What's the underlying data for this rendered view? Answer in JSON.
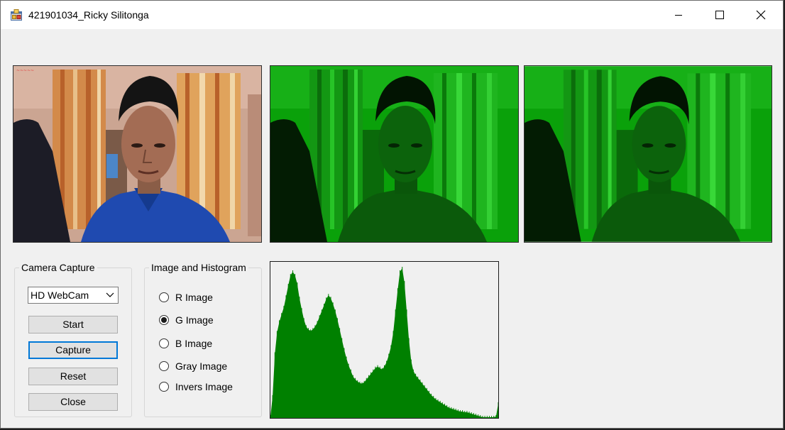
{
  "window": {
    "title": "421901034_Ricky Silitonga",
    "app_icon": "winforms-app-icon",
    "controls": [
      "minimize-icon",
      "maximize-icon",
      "close-icon"
    ]
  },
  "camera_group": {
    "title": "Camera Capture",
    "device_selected": "HD WebCam",
    "buttons": {
      "start": "Start",
      "capture": "Capture",
      "reset": "Reset",
      "close": "Close"
    }
  },
  "image_group": {
    "title": "Image and Histogram",
    "options": [
      {
        "label": "R Image",
        "checked": false
      },
      {
        "label": "G Image",
        "checked": true
      },
      {
        "label": "B Image",
        "checked": false
      },
      {
        "label": "Gray Image",
        "checked": false
      },
      {
        "label": "Invers Image",
        "checked": false
      }
    ]
  },
  "pictures": {
    "original": "webcam-photo",
    "channel": "green-channel-photo",
    "result": "green-channel-photo"
  },
  "colors": {
    "title_bg": "#ffffff",
    "client_bg": "#f0f0f0",
    "focus_border": "#0078d7",
    "histogram_fill": "#008000"
  },
  "chart_data": {
    "type": "area",
    "xlim": [
      0,
      255
    ],
    "values": [
      2,
      30,
      90,
      120,
      135,
      145,
      155,
      170,
      186,
      200,
      205,
      200,
      188,
      168,
      152,
      138,
      128,
      124,
      122,
      124,
      128,
      134,
      142,
      150,
      158,
      167,
      172,
      168,
      160,
      150,
      138,
      124,
      110,
      96,
      84,
      74,
      66,
      58,
      54,
      51,
      49,
      48,
      50,
      54,
      58,
      62,
      66,
      70,
      72,
      70,
      68,
      72,
      78,
      88,
      100,
      120,
      150,
      180,
      205,
      210,
      190,
      150,
      110,
      80,
      66,
      60,
      56,
      52,
      48,
      44,
      40,
      36,
      32,
      29,
      26,
      24,
      22,
      20,
      18,
      16,
      14,
      13,
      12,
      11,
      10,
      9,
      9,
      8,
      8,
      7,
      6,
      5,
      4,
      3,
      2,
      1,
      1,
      1,
      1,
      1,
      1,
      2,
      20
    ]
  }
}
